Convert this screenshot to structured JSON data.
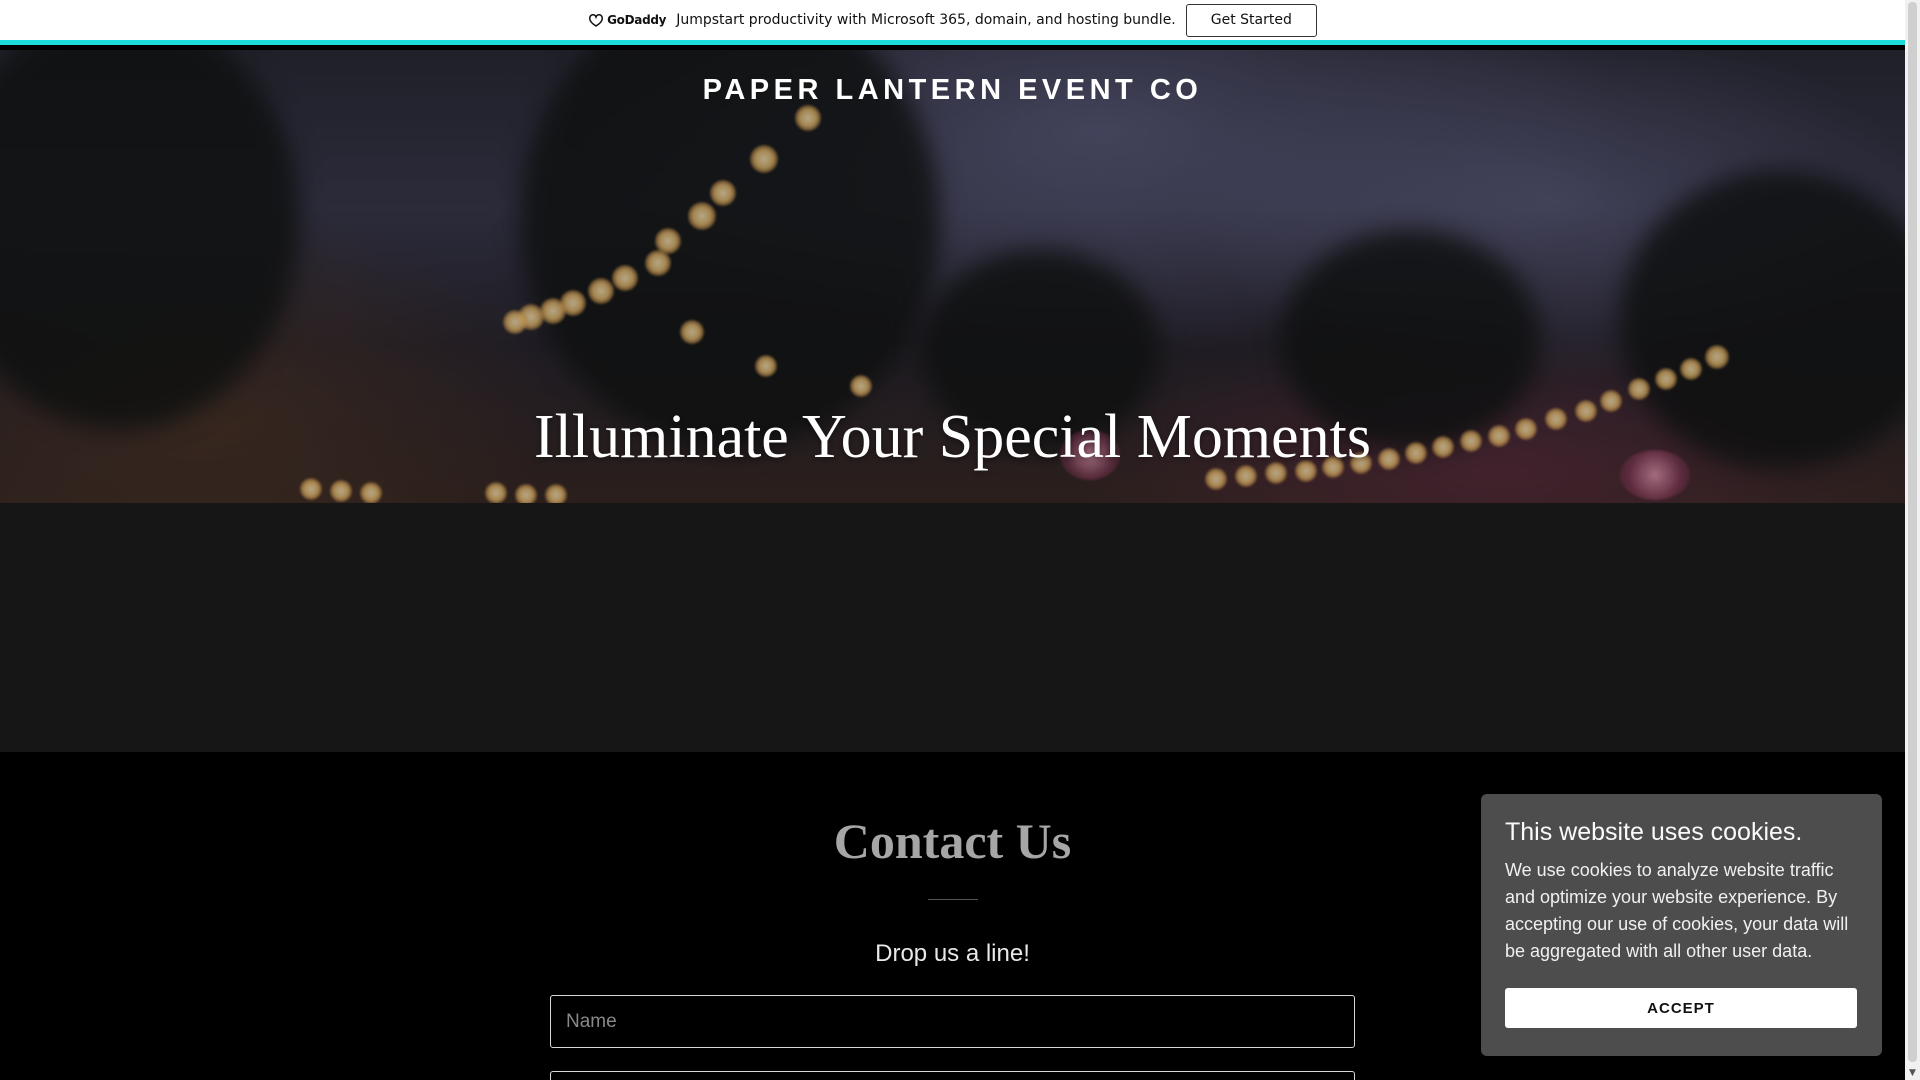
{
  "promo": {
    "logo_text": "GoDaddy",
    "message": "Jumpstart productivity with Microsoft 365, domain, and hosting bundle.",
    "cta_label": "Get Started",
    "accent_color": "#1bdbdb"
  },
  "hero": {
    "site_title": "PAPER LANTERN EVENT CO",
    "heading": "Illuminate Your Special Moments"
  },
  "contact": {
    "title": "Contact Us",
    "subtitle": "Drop us a line!",
    "name_placeholder": "Name"
  },
  "cookie_banner": {
    "title": "This website uses cookies.",
    "text": "We use cookies to analyze website traffic and optimize your website experience. By accepting our use of cookies, your data will be aggregated with all other user data.",
    "accept_label": "ACCEPT"
  },
  "scrollbar": {
    "down_arrow": "▼"
  }
}
